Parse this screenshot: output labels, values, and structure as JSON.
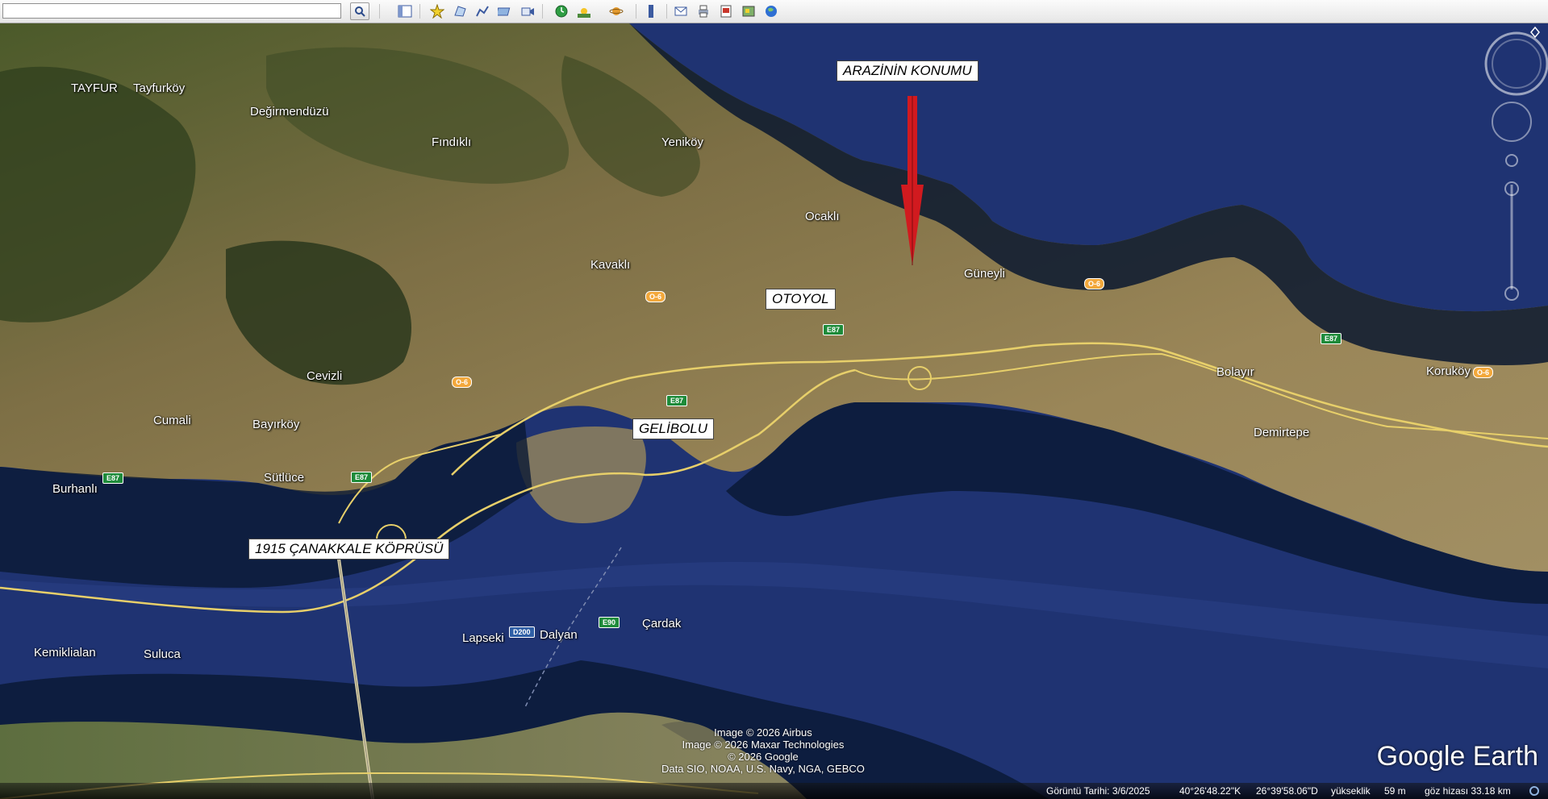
{
  "toolbar": {
    "search_placeholder": "",
    "buttons": [
      "search-button",
      "sidebar-toggle-button",
      "placemark-button",
      "polygon-button",
      "path-button",
      "image-overlay-button",
      "record-tour-button",
      "historical-imagery-button",
      "sunlight-button",
      "planets-button",
      "ruler-button",
      "email-button",
      "print-button",
      "save-image-button",
      "view-in-maps-button",
      "earth-button"
    ]
  },
  "places": [
    {
      "id": "tayfur",
      "label": "TAYFUR"
    },
    {
      "id": "tayfurkoy",
      "label": "Tayfurköy"
    },
    {
      "id": "degirmenduzu",
      "label": "Değirmendüzü"
    },
    {
      "id": "findikli",
      "label": "Fındıklı"
    },
    {
      "id": "yenikoy",
      "label": "Yeniköy"
    },
    {
      "id": "ocakli",
      "label": "Ocaklı"
    },
    {
      "id": "kavakli",
      "label": "Kavaklı"
    },
    {
      "id": "guneyli",
      "label": "Güneyli"
    },
    {
      "id": "cevizli",
      "label": "Cevizli"
    },
    {
      "id": "cumali",
      "label": "Cumali"
    },
    {
      "id": "bayirkoy",
      "label": "Bayırköy"
    },
    {
      "id": "sutluce",
      "label": "Sütlüce"
    },
    {
      "id": "burhanli",
      "label": "Burhanlı"
    },
    {
      "id": "bolayir",
      "label": "Bolayır"
    },
    {
      "id": "korukoy",
      "label": "Koruköy"
    },
    {
      "id": "demirtepe",
      "label": "Demirtepe"
    },
    {
      "id": "kemiklialan",
      "label": "Kemiklialan"
    },
    {
      "id": "suluca",
      "label": "Suluca"
    },
    {
      "id": "lapseki",
      "label": "Lapseki"
    },
    {
      "id": "dalyan",
      "label": "Dalyan"
    },
    {
      "id": "cardak",
      "label": "Çardak"
    }
  ],
  "callouts": {
    "arazi": "ARAZİNİN KONUMU",
    "otoyol": "OTOYOL",
    "gelibolu": "GELİBOLU",
    "kopru": "1915 ÇANAKKALE KÖPRÜSÜ"
  },
  "shields": [
    {
      "id": "o6a",
      "label": "O-6",
      "kind": "o"
    },
    {
      "id": "o6b",
      "label": "O-6",
      "kind": "o"
    },
    {
      "id": "o6c",
      "label": "O-6",
      "kind": "o"
    },
    {
      "id": "o6d",
      "label": "O-6",
      "kind": "o"
    },
    {
      "id": "e87a",
      "label": "E87",
      "kind": "e"
    },
    {
      "id": "e87b",
      "label": "E87",
      "kind": "e"
    },
    {
      "id": "e87c",
      "label": "E87",
      "kind": "e"
    },
    {
      "id": "e87d",
      "label": "E87",
      "kind": "e"
    },
    {
      "id": "e87e",
      "label": "E87",
      "kind": "e"
    },
    {
      "id": "e90",
      "label": "E90",
      "kind": "e"
    },
    {
      "id": "d200",
      "label": "D200",
      "kind": "d"
    }
  ],
  "credits": {
    "line1": "Image © 2026 Airbus",
    "line2": "Image © 2026 Maxar Technologies",
    "line3": "© 2026 Google",
    "line4": "Data SIO, NOAA, U.S. Navy, NGA, GEBCO"
  },
  "brand": "Google Earth",
  "status": {
    "imagery_date": "Görüntü Tarihi: 3/6/2025",
    "lat": "40°26'48.22\"K",
    "lon": "26°39'58.06\"D",
    "elev_label": "yükseklik",
    "elev": "59 m",
    "eye_alt": "göz hizası  33.18 km"
  },
  "colors": {
    "land": "#8a7b4f",
    "water": "#1c2f72",
    "deep_water": "#08162f",
    "road": "#e7cf6a",
    "arrow": "#d11a1f"
  }
}
